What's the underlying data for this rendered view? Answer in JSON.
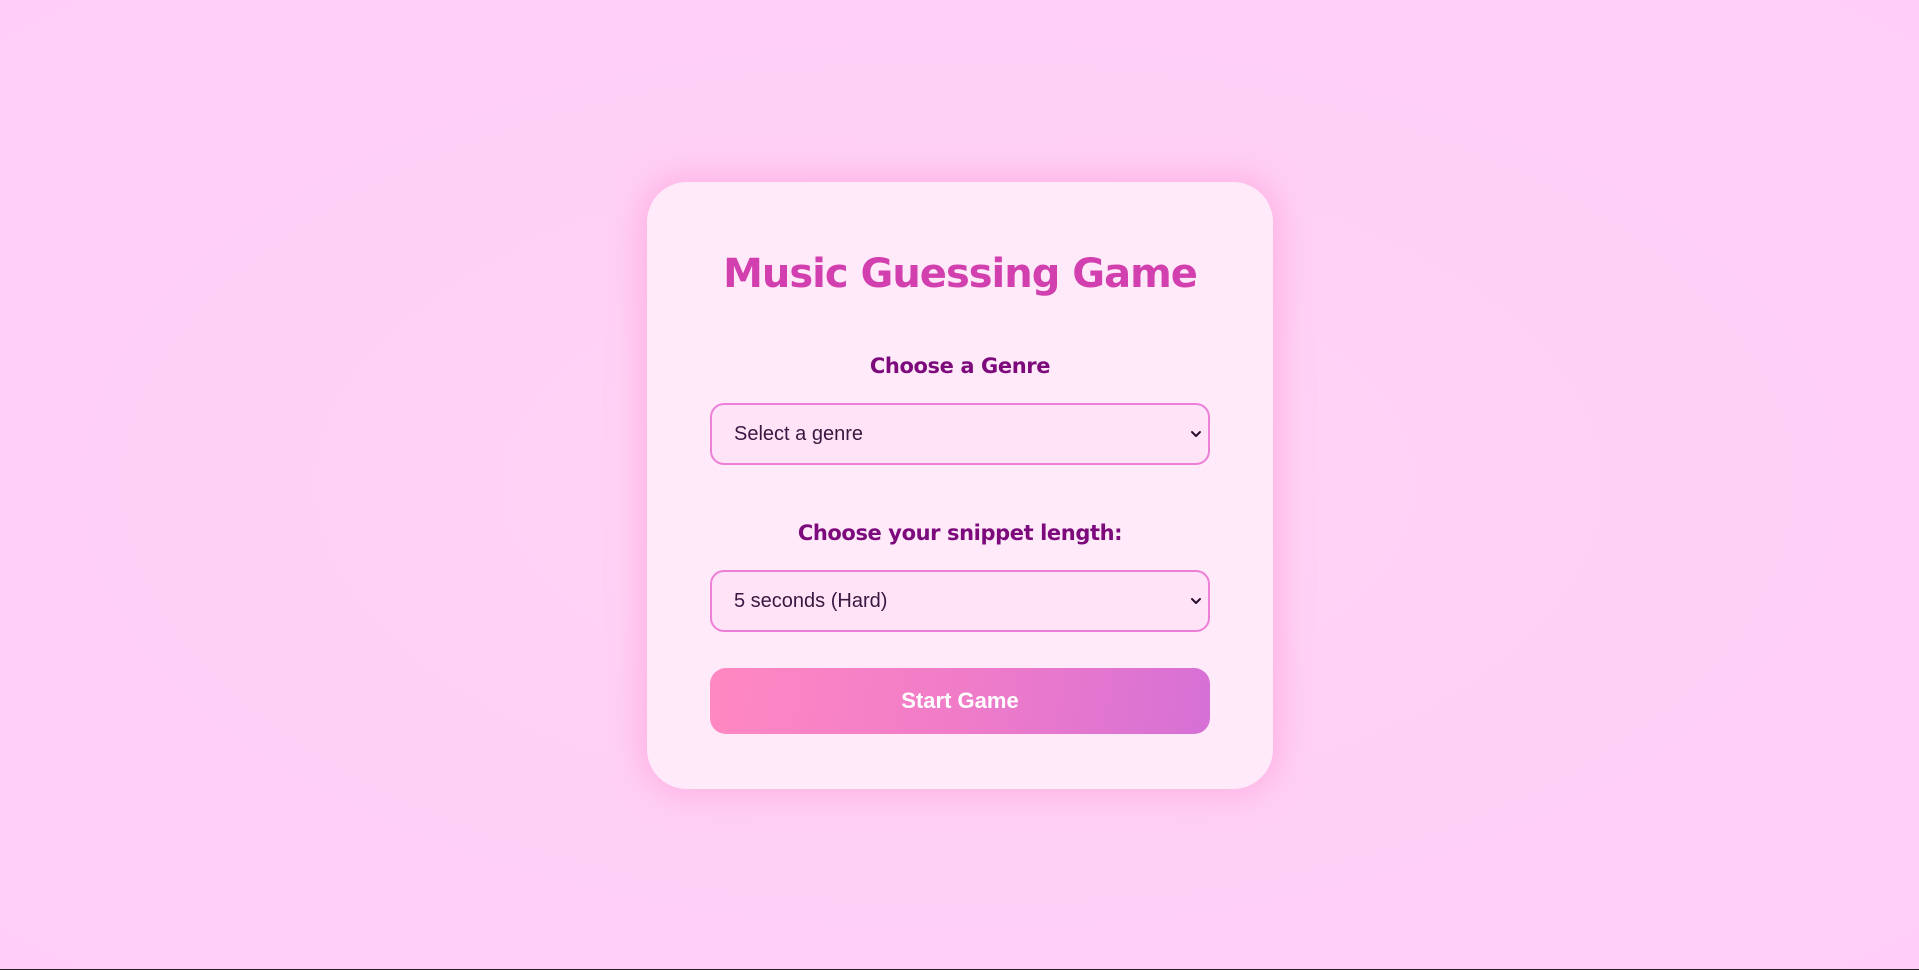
{
  "game": {
    "title": "Music Guessing Game",
    "genre": {
      "label": "Choose a Genre",
      "selected": "Select a genre"
    },
    "snippet": {
      "label": "Choose your snippet length:",
      "selected": "5 seconds (Hard)"
    },
    "start_label": "Start Game"
  },
  "icons": {
    "dropdown": "chevron-down-icon"
  },
  "colors": {
    "title": "#d23faf",
    "label": "#7c0a7c",
    "select_border": "#ee7fd6",
    "button_gradient_start": "#ff88c2",
    "button_gradient_end": "#d670d6"
  }
}
